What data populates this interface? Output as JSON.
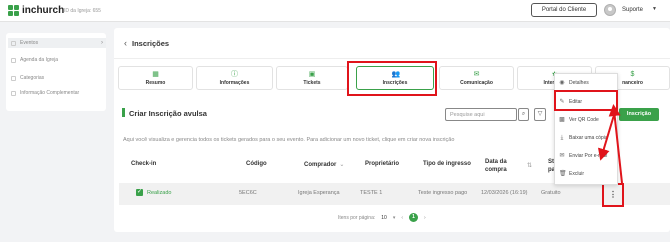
{
  "topbar": {
    "logo_text": "inchurch",
    "church_id": "ID da Igreja: 655",
    "portal_label": "Portal do Cliente",
    "user_label": "Suporte"
  },
  "sidebar": {
    "items": [
      {
        "label": "Eventos",
        "active": true
      },
      {
        "label": "Agenda da Igreja",
        "active": false
      },
      {
        "label": "Categorias",
        "active": false
      },
      {
        "label": "Informação Complementar",
        "active": false
      }
    ]
  },
  "page": {
    "title": "Inscrições"
  },
  "tabs": [
    {
      "label": "Resumo",
      "icon": "grid-icon"
    },
    {
      "label": "Informações",
      "icon": "info-icon"
    },
    {
      "label": "Tickets",
      "icon": "ticket-icon"
    },
    {
      "label": "Inscrições",
      "icon": "people-icon",
      "active": true
    },
    {
      "label": "Comunicação",
      "icon": "chat-icon"
    },
    {
      "label": "Interessa",
      "icon": "star-icon"
    },
    {
      "label": "nanceiro",
      "icon": "money-icon"
    }
  ],
  "section": {
    "title": "Criar Inscrição avulsa",
    "search_placeholder": "Pesquise aqui",
    "new_button": "Inscrição",
    "description": "Aqui você visualiza e gerencia todos os tickets gerados para o seu evento. Para adicionar um novo ticket, clique em criar nova inscrição"
  },
  "table": {
    "headers": {
      "checkin": "Check-in",
      "code": "Código",
      "buyer": "Comprador",
      "owner": "Proprietário",
      "type": "Tipo de ingresso",
      "date_l1": "Data da",
      "date_l2": "compra",
      "status_l1": "Sta",
      "status_l2": "pa"
    },
    "row": {
      "checkin": "Realizado",
      "code": "5EC6C",
      "buyer": "Igreja Esperança",
      "owner": "TESTE 1",
      "type": "Teste ingresso pago",
      "date": "12/03/2026 (16:19)",
      "status": "Gratuito"
    }
  },
  "pagination": {
    "per_page_label": "Itens por página:",
    "per_page_value": "10",
    "current_page": "1"
  },
  "menu": {
    "items": [
      {
        "label": "Detalhes",
        "icon": "eye-icon"
      },
      {
        "label": "Editar",
        "icon": "pencil-icon"
      },
      {
        "label": "Ver QR Code",
        "icon": "qr-icon"
      },
      {
        "label": "Baixar uma cópia",
        "icon": "download-icon"
      },
      {
        "label": "Enviar Por e-mail",
        "icon": "mail-icon"
      },
      {
        "label": "Excluir",
        "icon": "trash-icon"
      }
    ]
  },
  "colors": {
    "brand_green": "#3aa14a",
    "highlight_red": "#e0141b"
  }
}
